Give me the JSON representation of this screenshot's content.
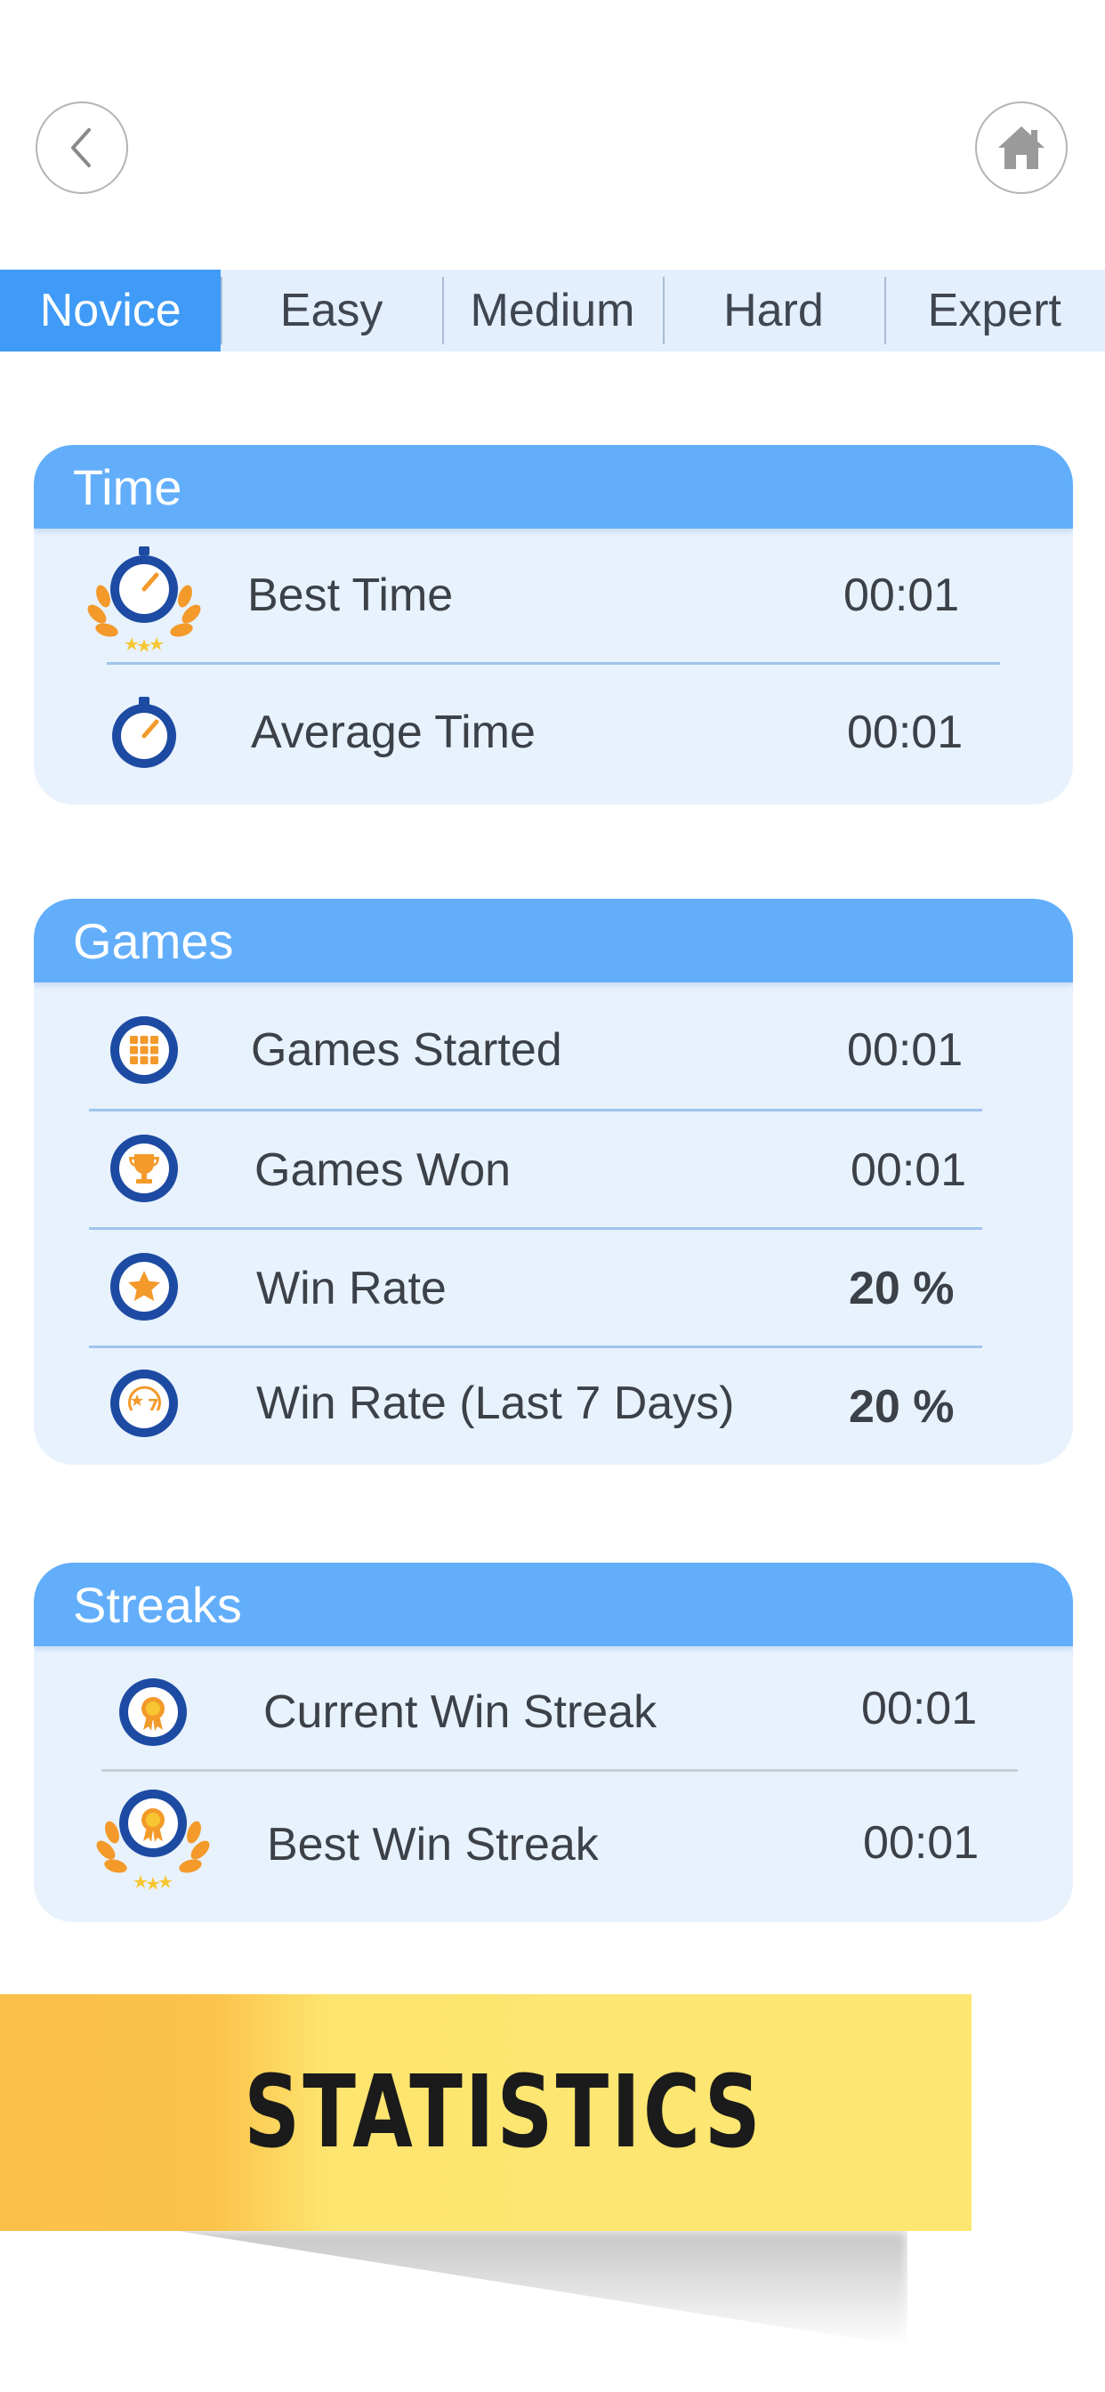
{
  "nav": {
    "back_icon": "chevron-left-icon",
    "home_icon": "home-icon"
  },
  "tabs": [
    {
      "label": "Novice",
      "active": true
    },
    {
      "label": "Easy",
      "active": false
    },
    {
      "label": "Medium",
      "active": false
    },
    {
      "label": "Hard",
      "active": false
    },
    {
      "label": "Expert",
      "active": false
    }
  ],
  "sections": {
    "time": {
      "title": "Time",
      "rows": [
        {
          "label": "Best Time",
          "value": "00:01",
          "icon": "stopwatch-laurel-icon"
        },
        {
          "label": "Average Time",
          "value": "00:01",
          "icon": "stopwatch-icon"
        }
      ]
    },
    "games": {
      "title": "Games",
      "rows": [
        {
          "label": "Games Started",
          "value": "00:01",
          "icon": "grid-icon"
        },
        {
          "label": "Games Won",
          "value": "00:01",
          "icon": "trophy-icon"
        },
        {
          "label": "Win Rate",
          "value": "20 %",
          "icon": "star-icon"
        },
        {
          "label": "Win Rate (Last 7 Days)",
          "value": "20 %",
          "icon": "seven-days-icon"
        }
      ]
    },
    "streaks": {
      "title": "Streaks",
      "rows": [
        {
          "label": "Current Win Streak",
          "value": "00:01",
          "icon": "medal-icon"
        },
        {
          "label": "Best Win Streak",
          "value": "00:01",
          "icon": "medal-laurel-icon"
        }
      ]
    }
  },
  "banner": {
    "title": "STATISTICS"
  },
  "colors": {
    "accent_blue": "#3f9bf7",
    "header_blue": "#62aefb",
    "card_bg": "#e8f2fd",
    "icon_navy": "#1d4ba3",
    "icon_orange": "#f39a2b",
    "banner_yellow": "#fde772"
  }
}
